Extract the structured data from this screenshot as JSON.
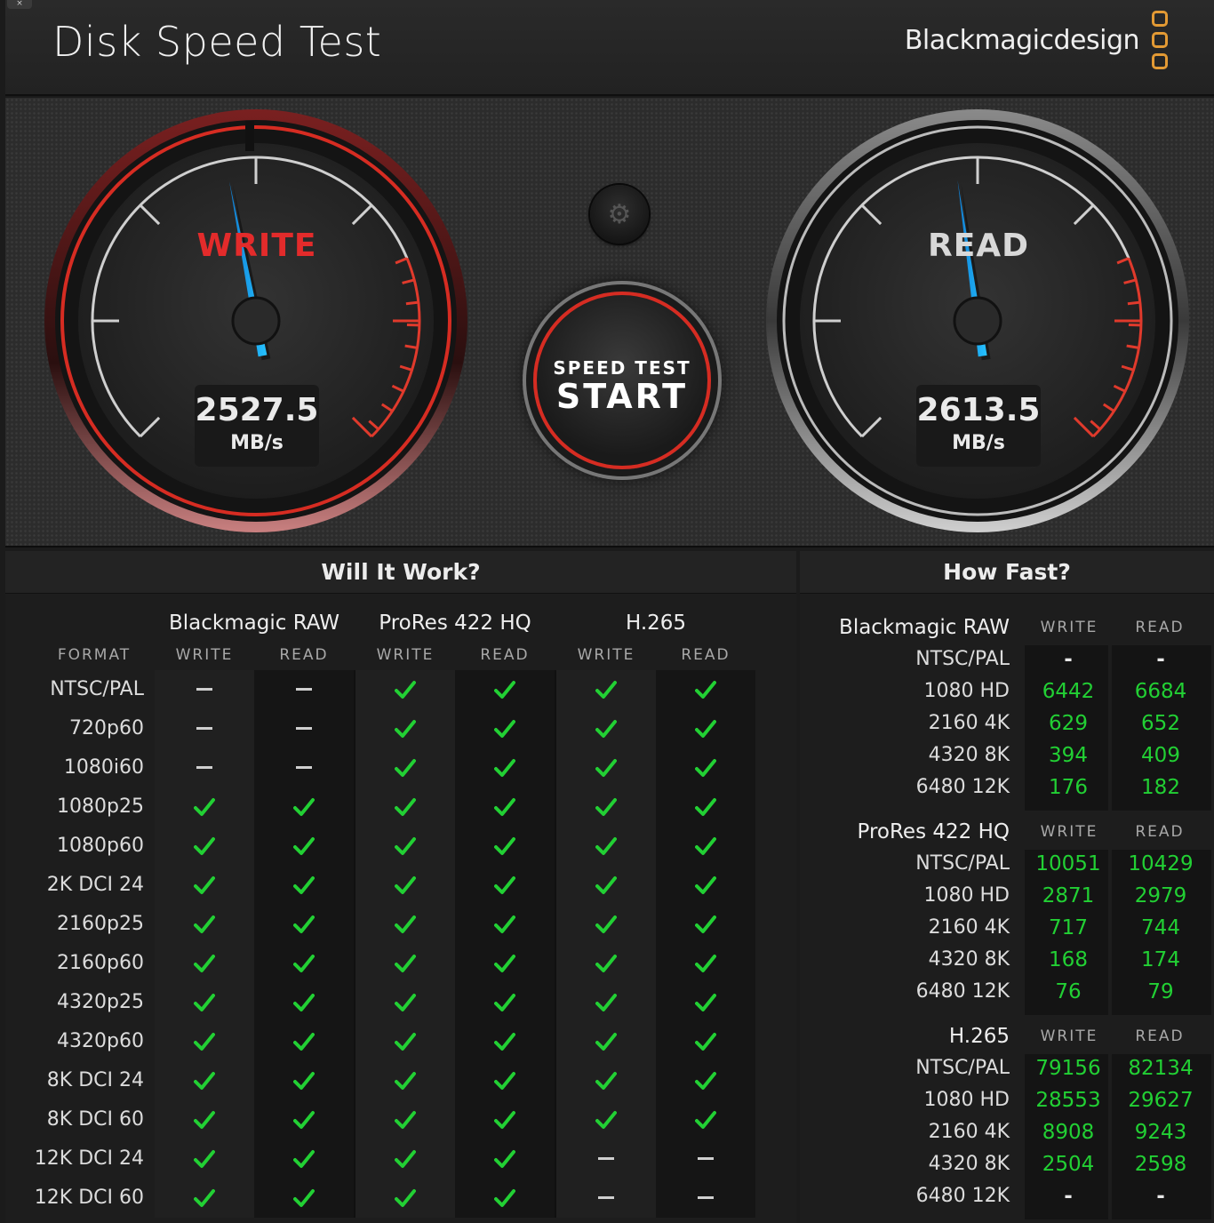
{
  "window": {
    "close_glyph": "×"
  },
  "header": {
    "title": "Disk Speed Test",
    "brand": "Blackmagicdesign"
  },
  "gauges": {
    "write": {
      "label": "WRITE",
      "value": "2527.5",
      "unit": "MB/s",
      "needle_fraction": 0.46
    },
    "read": {
      "label": "READ",
      "value": "2613.5",
      "unit": "MB/s",
      "needle_fraction": 0.47
    }
  },
  "start_button": {
    "small": "SPEED TEST",
    "big": "START"
  },
  "settings_icon": "gear-icon",
  "colors": {
    "accent_red": "#d62c22",
    "check_green": "#22d034",
    "brand_orange": "#e39a34"
  },
  "will_it_work": {
    "title": "Will It Work?",
    "format_header": "FORMAT",
    "codecs": [
      "Blackmagic RAW",
      "ProRes 422 HQ",
      "H.265"
    ],
    "subcols": [
      "WRITE",
      "READ",
      "WRITE",
      "READ",
      "WRITE",
      "READ"
    ],
    "rows": [
      {
        "format": "NTSC/PAL",
        "cells": [
          "dash",
          "dash",
          "check",
          "check",
          "check",
          "check"
        ]
      },
      {
        "format": "720p60",
        "cells": [
          "dash",
          "dash",
          "check",
          "check",
          "check",
          "check"
        ]
      },
      {
        "format": "1080i60",
        "cells": [
          "dash",
          "dash",
          "check",
          "check",
          "check",
          "check"
        ]
      },
      {
        "format": "1080p25",
        "cells": [
          "check",
          "check",
          "check",
          "check",
          "check",
          "check"
        ]
      },
      {
        "format": "1080p60",
        "cells": [
          "check",
          "check",
          "check",
          "check",
          "check",
          "check"
        ]
      },
      {
        "format": "2K DCI 24",
        "cells": [
          "check",
          "check",
          "check",
          "check",
          "check",
          "check"
        ]
      },
      {
        "format": "2160p25",
        "cells": [
          "check",
          "check",
          "check",
          "check",
          "check",
          "check"
        ]
      },
      {
        "format": "2160p60",
        "cells": [
          "check",
          "check",
          "check",
          "check",
          "check",
          "check"
        ]
      },
      {
        "format": "4320p25",
        "cells": [
          "check",
          "check",
          "check",
          "check",
          "check",
          "check"
        ]
      },
      {
        "format": "4320p60",
        "cells": [
          "check",
          "check",
          "check",
          "check",
          "check",
          "check"
        ]
      },
      {
        "format": "8K DCI 24",
        "cells": [
          "check",
          "check",
          "check",
          "check",
          "check",
          "check"
        ]
      },
      {
        "format": "8K DCI 60",
        "cells": [
          "check",
          "check",
          "check",
          "check",
          "check",
          "check"
        ]
      },
      {
        "format": "12K DCI 24",
        "cells": [
          "check",
          "check",
          "check",
          "check",
          "dash",
          "dash"
        ]
      },
      {
        "format": "12K DCI 60",
        "cells": [
          "check",
          "check",
          "check",
          "check",
          "dash",
          "dash"
        ]
      }
    ]
  },
  "how_fast": {
    "title": "How Fast?",
    "sections": [
      {
        "codec": "Blackmagic RAW",
        "write_header": "WRITE",
        "read_header": "READ",
        "rows": [
          {
            "format": "NTSC/PAL",
            "write": "-",
            "read": "-"
          },
          {
            "format": "1080 HD",
            "write": "6442",
            "read": "6684"
          },
          {
            "format": "2160 4K",
            "write": "629",
            "read": "652"
          },
          {
            "format": "4320 8K",
            "write": "394",
            "read": "409"
          },
          {
            "format": "6480 12K",
            "write": "176",
            "read": "182"
          }
        ]
      },
      {
        "codec": "ProRes 422 HQ",
        "write_header": "WRITE",
        "read_header": "READ",
        "rows": [
          {
            "format": "NTSC/PAL",
            "write": "10051",
            "read": "10429"
          },
          {
            "format": "1080 HD",
            "write": "2871",
            "read": "2979"
          },
          {
            "format": "2160 4K",
            "write": "717",
            "read": "744"
          },
          {
            "format": "4320 8K",
            "write": "168",
            "read": "174"
          },
          {
            "format": "6480 12K",
            "write": "76",
            "read": "79"
          }
        ]
      },
      {
        "codec": "H.265",
        "write_header": "WRITE",
        "read_header": "READ",
        "rows": [
          {
            "format": "NTSC/PAL",
            "write": "79156",
            "read": "82134"
          },
          {
            "format": "1080 HD",
            "write": "28553",
            "read": "29627"
          },
          {
            "format": "2160 4K",
            "write": "8908",
            "read": "9243"
          },
          {
            "format": "4320 8K",
            "write": "2504",
            "read": "2598"
          },
          {
            "format": "6480 12K",
            "write": "-",
            "read": "-"
          }
        ]
      }
    ]
  }
}
